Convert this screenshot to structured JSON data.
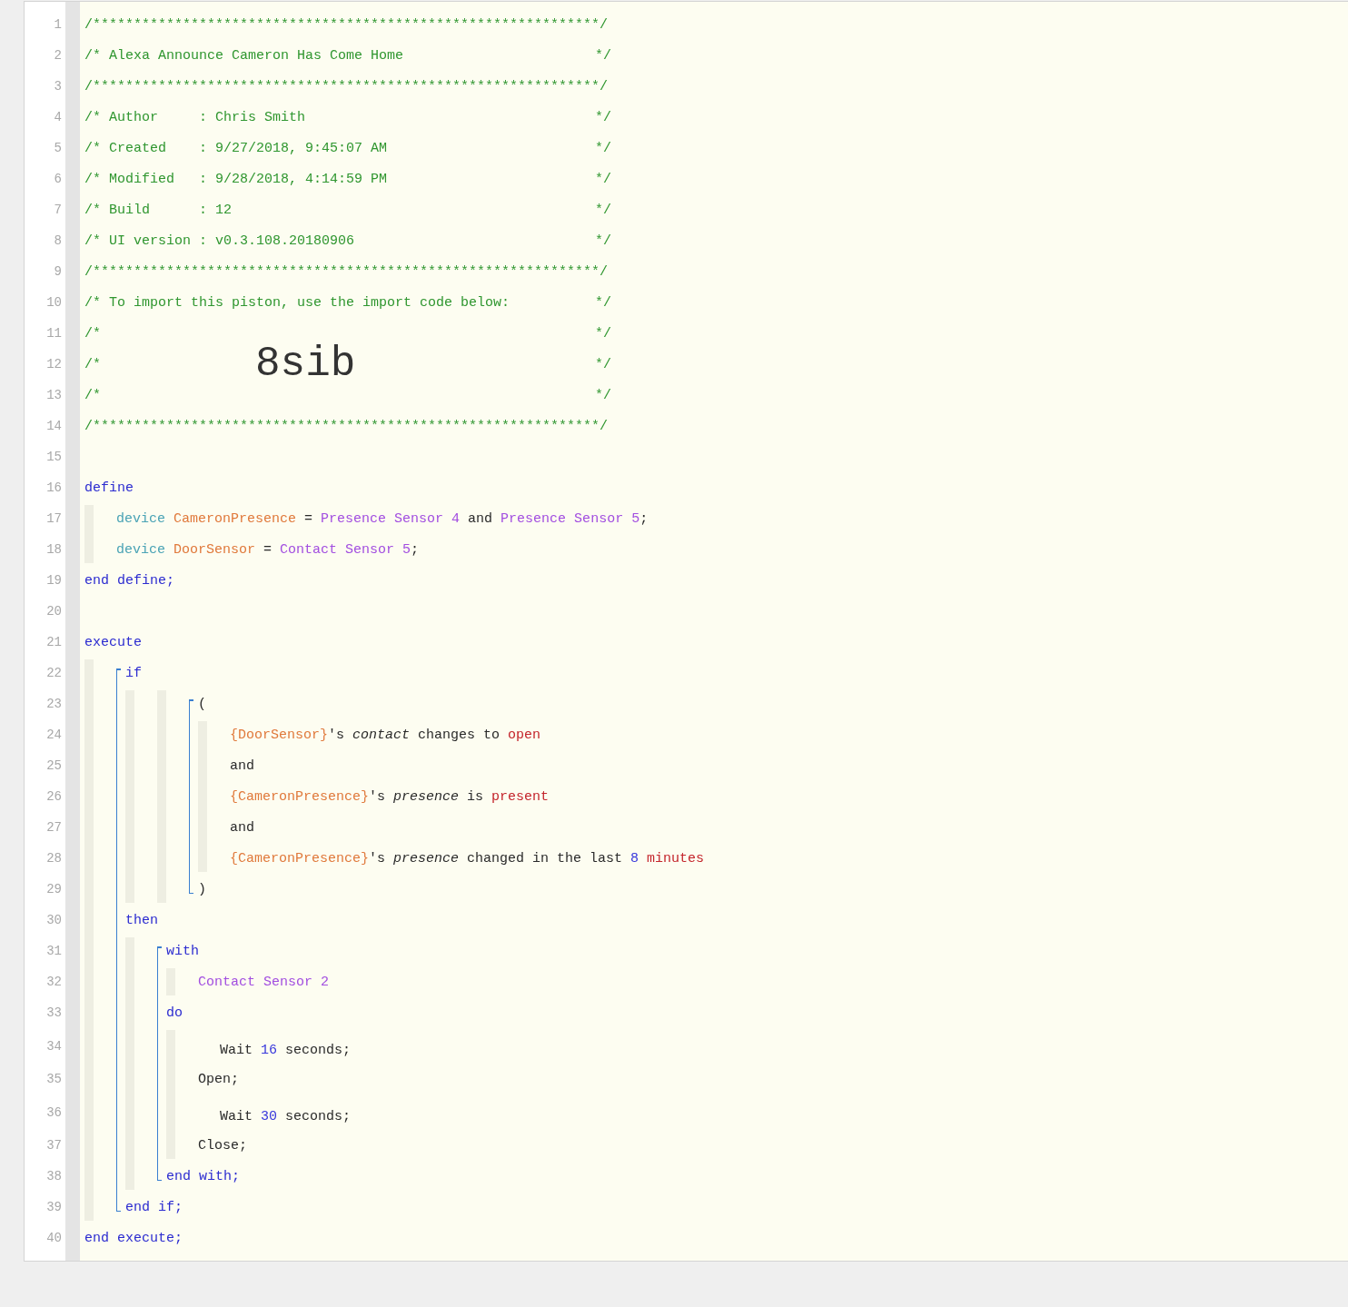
{
  "editor": {
    "lines": [
      {
        "n": "1",
        "tokens": [
          {
            "kind": "comment",
            "text": "/**************************************************************/"
          }
        ]
      },
      {
        "n": "2",
        "tokens": [
          {
            "kind": "comment",
            "text": "/* Alexa Announce Cameron Has Come Home"
          },
          {
            "kind": "comment-close",
            "text": "*/"
          }
        ]
      },
      {
        "n": "3",
        "tokens": [
          {
            "kind": "comment",
            "text": "/**************************************************************/"
          }
        ]
      },
      {
        "n": "4",
        "tokens": [
          {
            "kind": "comment",
            "text": "/* Author     : Chris Smith"
          },
          {
            "kind": "comment-close",
            "text": "*/"
          }
        ]
      },
      {
        "n": "5",
        "tokens": [
          {
            "kind": "comment",
            "text": "/* Created    : 9/27/2018, 9:45:07 AM"
          },
          {
            "kind": "comment-close",
            "text": "*/"
          }
        ]
      },
      {
        "n": "6",
        "tokens": [
          {
            "kind": "comment",
            "text": "/* Modified   : 9/28/2018, 4:14:59 PM"
          },
          {
            "kind": "comment-close",
            "text": "*/"
          }
        ]
      },
      {
        "n": "7",
        "tokens": [
          {
            "kind": "comment",
            "text": "/* Build      : 12"
          },
          {
            "kind": "comment-close",
            "text": "*/"
          }
        ]
      },
      {
        "n": "8",
        "tokens": [
          {
            "kind": "comment",
            "text": "/* UI version : v0.3.108.20180906"
          },
          {
            "kind": "comment-close",
            "text": "*/"
          }
        ]
      },
      {
        "n": "9",
        "tokens": [
          {
            "kind": "comment",
            "text": "/**************************************************************/"
          }
        ]
      },
      {
        "n": "10",
        "tokens": [
          {
            "kind": "comment",
            "text": "/* To import this piston, use the import code below:"
          },
          {
            "kind": "comment-close",
            "text": "*/"
          }
        ]
      },
      {
        "n": "11",
        "tokens": [
          {
            "kind": "comment",
            "text": "/*"
          },
          {
            "kind": "comment-close",
            "text": "*/"
          }
        ]
      },
      {
        "n": "12",
        "tokens": [
          {
            "kind": "comment",
            "text": "/*"
          },
          {
            "kind": "import-code",
            "text": "8sib"
          },
          {
            "kind": "comment-close",
            "text": "*/"
          }
        ]
      },
      {
        "n": "13",
        "tokens": [
          {
            "kind": "comment",
            "text": "/*"
          },
          {
            "kind": "comment-close",
            "text": "*/"
          }
        ]
      },
      {
        "n": "14",
        "tokens": [
          {
            "kind": "comment",
            "text": "/**************************************************************/"
          }
        ]
      },
      {
        "n": "15"
      },
      {
        "n": "16",
        "tokens": [
          {
            "kind": "keyword",
            "text": "define"
          }
        ]
      },
      {
        "kind": "strip",
        "children": [
          {
            "n": "17",
            "tokens": [
              {
                "kind": "device-keyword",
                "text": "device "
              },
              {
                "kind": "variable",
                "text": "CameronPresence "
              },
              {
                "kind": "plain",
                "text": "= "
              },
              {
                "kind": "device",
                "text": "Presence Sensor 4 "
              },
              {
                "kind": "plain",
                "text": "and "
              },
              {
                "kind": "device",
                "text": "Presence Sensor 5"
              },
              {
                "kind": "plain",
                "text": ";"
              }
            ]
          },
          {
            "n": "18",
            "tokens": [
              {
                "kind": "device-keyword",
                "text": "device "
              },
              {
                "kind": "variable",
                "text": "DoorSensor "
              },
              {
                "kind": "plain",
                "text": "= "
              },
              {
                "kind": "device",
                "text": "Contact Sensor 5"
              },
              {
                "kind": "plain",
                "text": ";"
              }
            ]
          }
        ]
      },
      {
        "n": "19",
        "tokens": [
          {
            "kind": "keyword",
            "text": "end define;"
          }
        ]
      },
      {
        "n": "20"
      },
      {
        "n": "21",
        "tokens": [
          {
            "kind": "keyword",
            "text": "execute"
          }
        ]
      },
      {
        "kind": "strip",
        "children": [
          {
            "kind": "bracket",
            "children": [
              {
                "n": "22",
                "tokens": [
                  {
                    "kind": "keyword",
                    "text": "if"
                  }
                ]
              },
              {
                "kind": "strip",
                "children": [
                  {
                    "kind": "strip",
                    "children": [
                      {
                        "kind": "bracket",
                        "children": [
                          {
                            "n": "23",
                            "tokens": [
                              {
                                "kind": "plain",
                                "text": "("
                              }
                            ]
                          },
                          {
                            "kind": "strip",
                            "children": [
                              {
                                "n": "24",
                                "tokens": [
                                  {
                                    "kind": "variable",
                                    "text": "{DoorSensor}"
                                  },
                                  {
                                    "kind": "plain",
                                    "text": "'s "
                                  },
                                  {
                                    "kind": "attribute",
                                    "text": "contact "
                                  },
                                  {
                                    "kind": "plain",
                                    "text": "changes to "
                                  },
                                  {
                                    "kind": "value",
                                    "text": "open"
                                  }
                                ]
                              },
                              {
                                "n": "25",
                                "tokens": [
                                  {
                                    "kind": "plain",
                                    "text": "and"
                                  }
                                ]
                              },
                              {
                                "n": "26",
                                "tokens": [
                                  {
                                    "kind": "variable",
                                    "text": "{CameronPresence}"
                                  },
                                  {
                                    "kind": "plain",
                                    "text": "'s "
                                  },
                                  {
                                    "kind": "attribute",
                                    "text": "presence "
                                  },
                                  {
                                    "kind": "plain",
                                    "text": "is "
                                  },
                                  {
                                    "kind": "value",
                                    "text": "present"
                                  }
                                ]
                              },
                              {
                                "n": "27",
                                "tokens": [
                                  {
                                    "kind": "plain",
                                    "text": "and"
                                  }
                                ]
                              },
                              {
                                "n": "28",
                                "tokens": [
                                  {
                                    "kind": "variable",
                                    "text": "{CameronPresence}"
                                  },
                                  {
                                    "kind": "plain",
                                    "text": "'s "
                                  },
                                  {
                                    "kind": "attribute",
                                    "text": "presence "
                                  },
                                  {
                                    "kind": "plain",
                                    "text": "changed in the last "
                                  },
                                  {
                                    "kind": "number",
                                    "text": "8 "
                                  },
                                  {
                                    "kind": "value",
                                    "text": "minutes"
                                  }
                                ]
                              }
                            ]
                          },
                          {
                            "n": "29",
                            "tokens": [
                              {
                                "kind": "plain",
                                "text": ")"
                              }
                            ]
                          }
                        ]
                      }
                    ]
                  }
                ]
              },
              {
                "n": "30",
                "tokens": [
                  {
                    "kind": "keyword",
                    "text": "then"
                  }
                ]
              },
              {
                "kind": "strip",
                "children": [
                  {
                    "kind": "bracket",
                    "children": [
                      {
                        "n": "31",
                        "tokens": [
                          {
                            "kind": "keyword",
                            "text": "with"
                          }
                        ]
                      },
                      {
                        "kind": "strip",
                        "children": [
                          {
                            "n": "32",
                            "tokens": [
                              {
                                "kind": "device",
                                "text": "Contact Sensor 2"
                              }
                            ]
                          }
                        ]
                      },
                      {
                        "n": "33",
                        "tokens": [
                          {
                            "kind": "keyword",
                            "text": "do"
                          }
                        ]
                      },
                      {
                        "kind": "strip",
                        "children": [
                          {
                            "kind": "indent",
                            "children": [
                              {
                                "n": "34",
                                "tokens": [
                                  {
                                    "kind": "plain",
                                    "text": "Wait "
                                  },
                                  {
                                    "kind": "number",
                                    "text": "16 "
                                  },
                                  {
                                    "kind": "plain",
                                    "text": "seconds;"
                                  }
                                ]
                              }
                            ]
                          },
                          {
                            "n": "35",
                            "tokens": [
                              {
                                "kind": "plain",
                                "text": "Open;"
                              }
                            ]
                          },
                          {
                            "kind": "indent",
                            "children": [
                              {
                                "n": "36",
                                "tokens": [
                                  {
                                    "kind": "plain",
                                    "text": "Wait "
                                  },
                                  {
                                    "kind": "number",
                                    "text": "30 "
                                  },
                                  {
                                    "kind": "plain",
                                    "text": "seconds;"
                                  }
                                ]
                              }
                            ]
                          },
                          {
                            "n": "37",
                            "tokens": [
                              {
                                "kind": "plain",
                                "text": "Close;"
                              }
                            ]
                          }
                        ]
                      },
                      {
                        "n": "38",
                        "tokens": [
                          {
                            "kind": "keyword",
                            "text": "end with;"
                          }
                        ]
                      }
                    ]
                  }
                ]
              },
              {
                "n": "39",
                "tokens": [
                  {
                    "kind": "keyword",
                    "text": "end if;"
                  }
                ]
              }
            ]
          }
        ]
      },
      {
        "n": "40",
        "tokens": [
          {
            "kind": "keyword",
            "text": "end execute;"
          }
        ]
      }
    ]
  }
}
